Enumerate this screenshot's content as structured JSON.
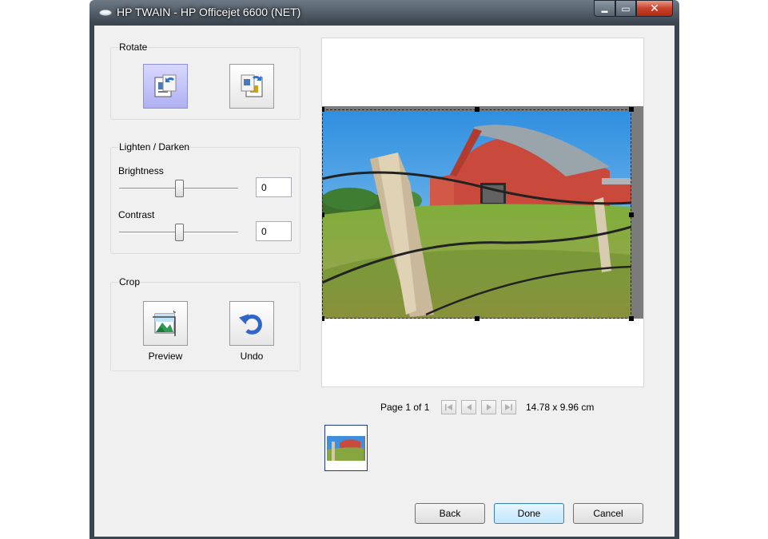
{
  "window": {
    "title": "HP TWAIN - HP Officejet 6600 (NET)"
  },
  "caption_buttons": {
    "minimize": "▬",
    "maximize": "▭",
    "close": "✕"
  },
  "rotate": {
    "title": "Rotate",
    "left_icon": "rotate-left-icon",
    "right_icon": "rotate-right-icon"
  },
  "lighten": {
    "title": "Lighten / Darken",
    "brightness_label": "Brightness",
    "brightness_value": "0",
    "contrast_label": "Contrast",
    "contrast_value": "0"
  },
  "crop": {
    "title": "Crop",
    "preview_label": "Preview",
    "undo_label": "Undo"
  },
  "pager": {
    "page_text": "Page 1 of 1",
    "size_text": "14.78 x 9.96 cm"
  },
  "buttons": {
    "back": "Back",
    "done": "Done",
    "cancel": "Cancel"
  },
  "colors": {
    "accent": "#3c7fb1",
    "active_tool": "#aeb0f2"
  }
}
